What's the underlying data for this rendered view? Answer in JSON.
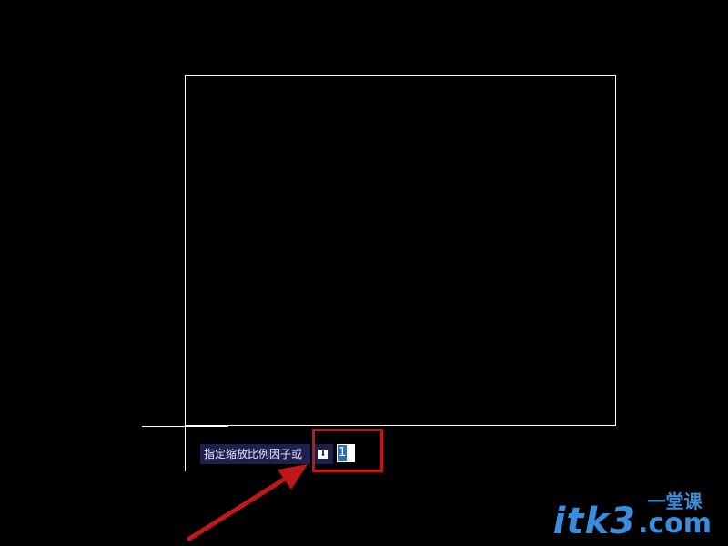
{
  "cad": {
    "prompt_text": "指定缩放比例因子或",
    "dropdown_glyph": "⬇",
    "input_value": "1",
    "input_selected": true
  },
  "annotation": {
    "highlight_color": "#c01818",
    "arrow_color": "#c01818"
  },
  "watermark": {
    "main": "itk3",
    "cn": "一堂课",
    "com": ".com",
    "color": "#3a8cdc"
  },
  "colors": {
    "background": "#000000",
    "geometry": "#ffffff",
    "prompt_bg": "#1f1f4f",
    "selection": "#2e6fb5"
  }
}
